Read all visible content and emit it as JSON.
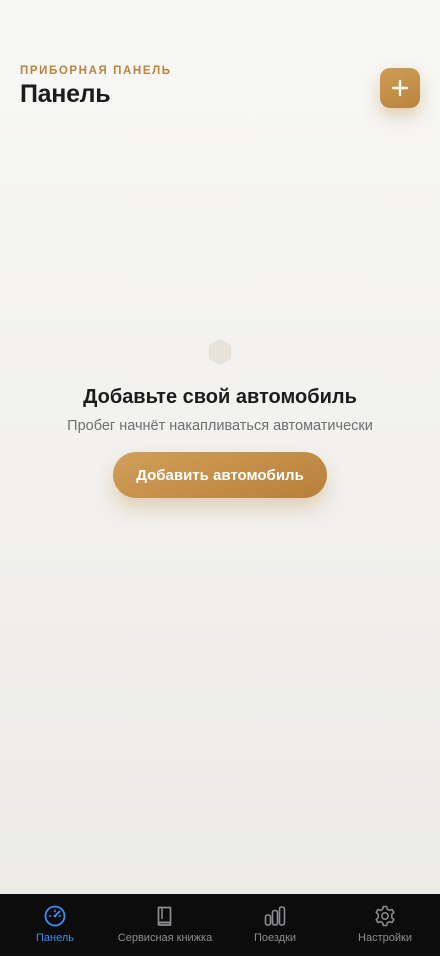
{
  "header": {
    "eyebrow": "ПРИБОРНАЯ ПАНЕЛЬ",
    "title": "Панель",
    "add_icon": "plus-icon"
  },
  "empty_state": {
    "icon": "hexagon-icon",
    "title": "Добавьте свой автомобиль",
    "subtitle": "Пробег начнёт накапливаться автоматически",
    "button_label": "Добавить автомобиль"
  },
  "tabbar": {
    "items": [
      {
        "label": "Панель",
        "icon": "speedometer-icon",
        "active": true
      },
      {
        "label": "Сервисная книжка",
        "icon": "book-icon",
        "active": false
      },
      {
        "label": "Поездки",
        "icon": "bar-chart-icon",
        "active": false
      },
      {
        "label": "Настройки",
        "icon": "gear-icon",
        "active": false
      }
    ]
  },
  "colors": {
    "accent": "#b8843e",
    "active_tab": "#3d8ef5",
    "tabbar_bg": "#0c0c0d",
    "background": "#f3f2ef"
  }
}
